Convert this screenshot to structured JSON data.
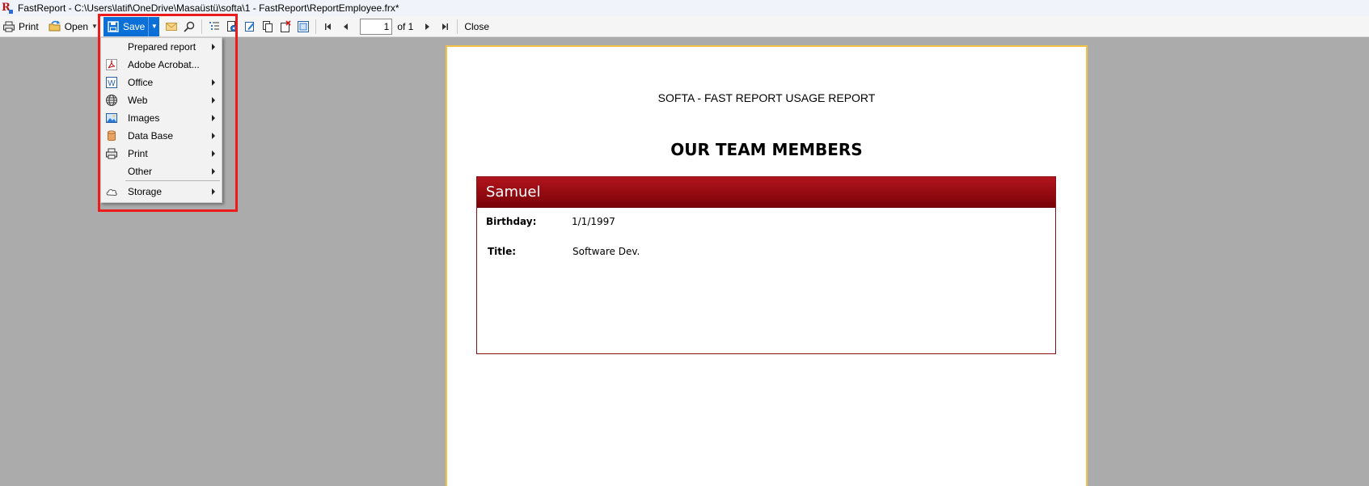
{
  "window": {
    "title": "FastReport - C:\\Users\\latif\\OneDrive\\Masaüstü\\softa\\1 - FastReport\\ReportEmployee.frx*"
  },
  "toolbar": {
    "print_label": "Print",
    "open_label": "Open",
    "save_label": "Save",
    "page_value": "1",
    "page_of": "of 1",
    "close_label": "Close"
  },
  "save_menu": {
    "items": [
      {
        "label": "Prepared report",
        "icon": "none",
        "submenu": true
      },
      {
        "label": "Adobe Acrobat...",
        "icon": "pdf-icon",
        "submenu": false
      },
      {
        "label": "Office",
        "icon": "word-icon",
        "submenu": true
      },
      {
        "label": "Web",
        "icon": "globe-icon",
        "submenu": true
      },
      {
        "label": "Images",
        "icon": "image-icon",
        "submenu": true
      },
      {
        "label": "Data Base",
        "icon": "database-icon",
        "submenu": true
      },
      {
        "label": "Print",
        "icon": "printer-icon",
        "submenu": true
      },
      {
        "label": "Other",
        "icon": "none",
        "submenu": true
      },
      {
        "label": "Storage",
        "icon": "cloud-icon",
        "submenu": true
      }
    ]
  },
  "report": {
    "heading": "SOFTA - FAST REPORT USAGE REPORT",
    "title": "OUR TEAM MEMBERS",
    "employee": {
      "name": "Samuel",
      "birthday_label": "Birthday:",
      "birthday_value": "1/1/1997",
      "title_label": "Title:",
      "title_value": "Software Dev."
    }
  },
  "colors": {
    "save_button": "#0a6fd6",
    "highlight": "#ec1c1c",
    "card_header": "#8b0d16",
    "page_border": "#f5c343",
    "workspace": "#ababab"
  }
}
